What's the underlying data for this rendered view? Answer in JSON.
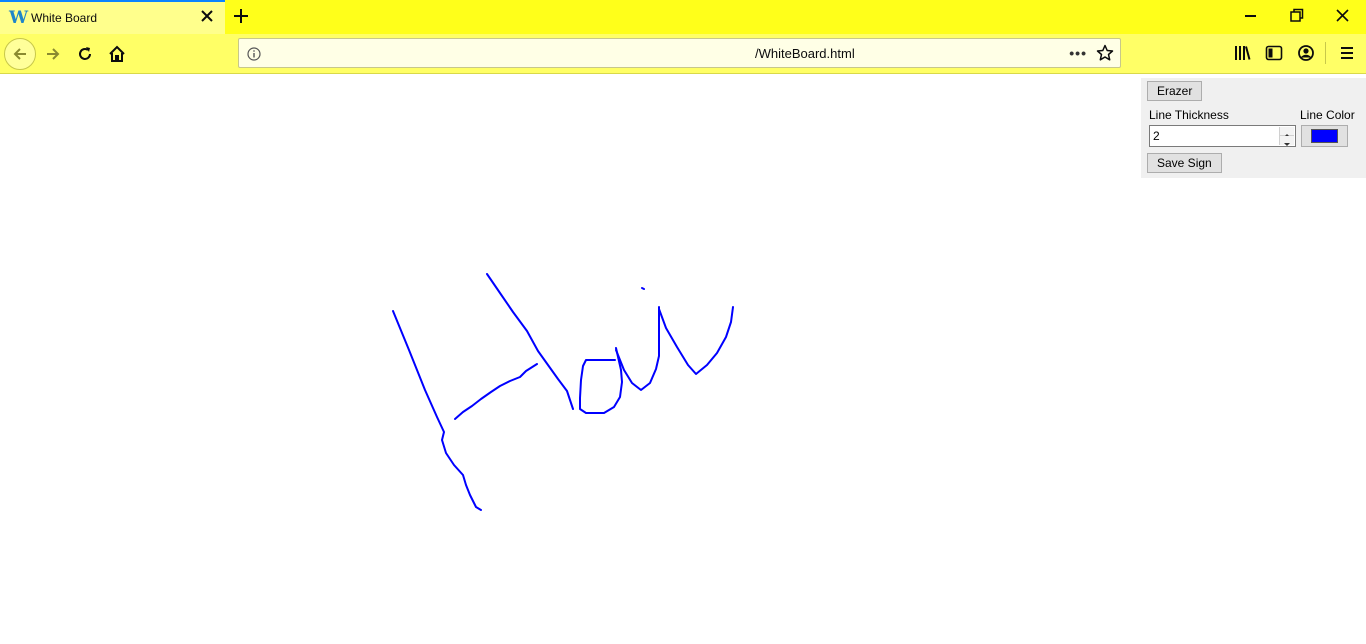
{
  "browser": {
    "tab": {
      "favicon_letter": "W",
      "title": "White Board"
    },
    "url_suffix": "/WhiteBoard.html",
    "chrome_color": "#ffff1a",
    "toolbar_color": "#ffff66"
  },
  "whiteboard": {
    "controls": {
      "eraser_label": "Erazer",
      "thickness_label": "Line Thickness",
      "thickness_value": "2",
      "color_label": "Line Color",
      "color_value": "#0000ff",
      "save_label": "Save Sign"
    },
    "stroke_color": "#0000ff",
    "stroke_width": 2
  },
  "icons": {
    "tab": [
      "close-icon",
      "plus-icon"
    ],
    "window": [
      "minimize-icon",
      "restore-icon",
      "close-window-icon"
    ],
    "navigation": [
      "back-arrow-icon",
      "forward-arrow-icon",
      "reload-icon",
      "home-icon"
    ],
    "urlbar": [
      "info-icon",
      "more-dots-icon",
      "star-icon"
    ],
    "toolbar": [
      "library-icon",
      "sidebar-icon",
      "account-icon",
      "menu-icon"
    ]
  }
}
